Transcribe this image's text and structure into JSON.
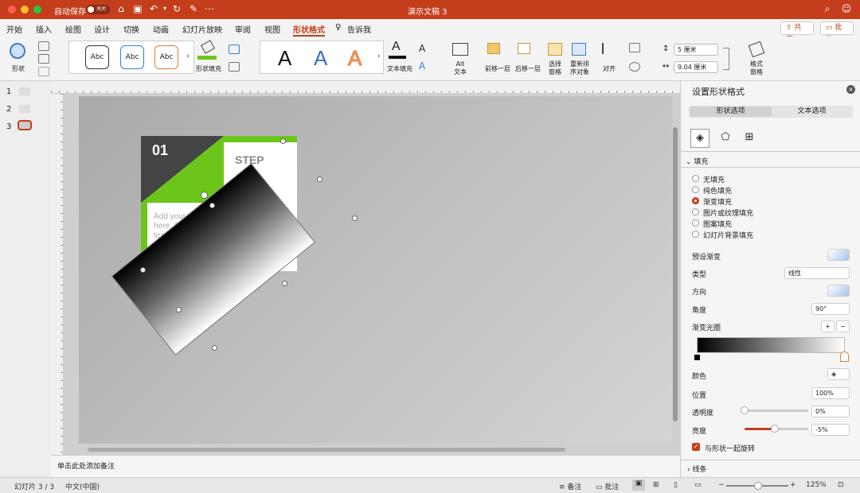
{
  "titlebar": {
    "autosave_label": "自动保存",
    "autosave_state": "关闭",
    "doc_title": "演示文稿 3"
  },
  "menu": {
    "tabs": [
      "开始",
      "插入",
      "绘图",
      "设计",
      "切换",
      "动画",
      "幻灯片放映",
      "审阅",
      "视图",
      "形状格式"
    ],
    "tell_me": "告诉我",
    "share": "共享",
    "comments": "批注"
  },
  "ribbon": {
    "shapes_label": "形状",
    "style_presets": [
      "Abc",
      "Abc",
      "Abc"
    ],
    "shape_fill_label": "形状填充",
    "wordart_letters": [
      "A",
      "A",
      "A"
    ],
    "text_fill_label": "文本填充",
    "alt_text_label": "Alt\n文本",
    "bring_forward_label": "前移一层",
    "send_backward_label": "后移一层",
    "selection_pane_label": "选择\n窗格",
    "reorder_label": "重新排\n序对象",
    "align_label": "对齐",
    "height_value": "5 厘米",
    "width_value": "9.04 厘米",
    "format_pane_label": "格式\n窗格"
  },
  "thumbnails": [
    "1",
    "2",
    "3"
  ],
  "slide": {
    "step_number": "01",
    "step_title": "STEP",
    "body_text": "Add your text here. Add your text here. Add your"
  },
  "notes_placeholder": "单击此处添加备注",
  "panel": {
    "title": "设置形状格式",
    "tabs": [
      "形状选项",
      "文本选项"
    ],
    "fill_section": "填充",
    "fill_options": [
      "无填充",
      "纯色填充",
      "渐变填充",
      "图片或纹理填充",
      "图案填充",
      "幻灯片背景填充"
    ],
    "fill_selected": 2,
    "preset_gradient_label": "预设渐变",
    "type_label": "类型",
    "type_value": "线性",
    "direction_label": "方向",
    "angle_label": "角度",
    "angle_value": "90°",
    "stops_label": "渐变光圈",
    "color_label": "颜色",
    "position_label": "位置",
    "position_value": "100%",
    "transparency_label": "透明度",
    "transparency_value": "0%",
    "transparency_level": 0,
    "brightness_label": "亮度",
    "brightness_value": "-5%",
    "brightness_level": 0.48,
    "rotate_with_shape_label": "与形状一起旋转",
    "line_section": "线条"
  },
  "status": {
    "slide_info": "幻灯片 3 / 3",
    "language": "中文(中国)",
    "notes": "备注",
    "comments": "批注",
    "zoom": "125%"
  },
  "colors": {
    "accent": "#c43e1c",
    "green": "#6cc51b",
    "dark": "#444444"
  }
}
